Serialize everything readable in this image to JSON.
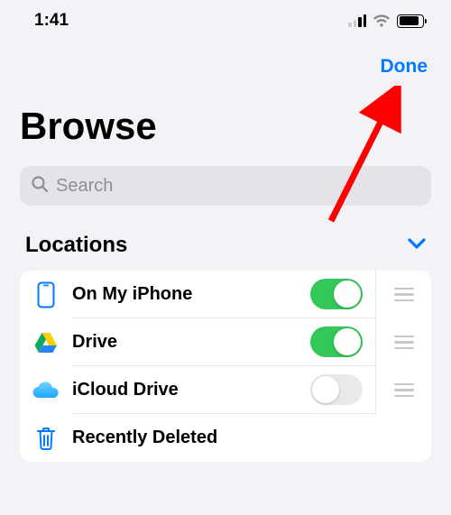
{
  "status": {
    "time": "1:41"
  },
  "nav": {
    "done": "Done"
  },
  "title": "Browse",
  "search": {
    "placeholder": "Search"
  },
  "section": {
    "title": "Locations"
  },
  "rows": {
    "onmyiphone": {
      "label": "On My iPhone",
      "toggle": true
    },
    "drive": {
      "label": "Drive",
      "toggle": true
    },
    "icloud": {
      "label": "iCloud Drive",
      "toggle": false
    },
    "recentlydeleted": {
      "label": "Recently Deleted"
    }
  }
}
